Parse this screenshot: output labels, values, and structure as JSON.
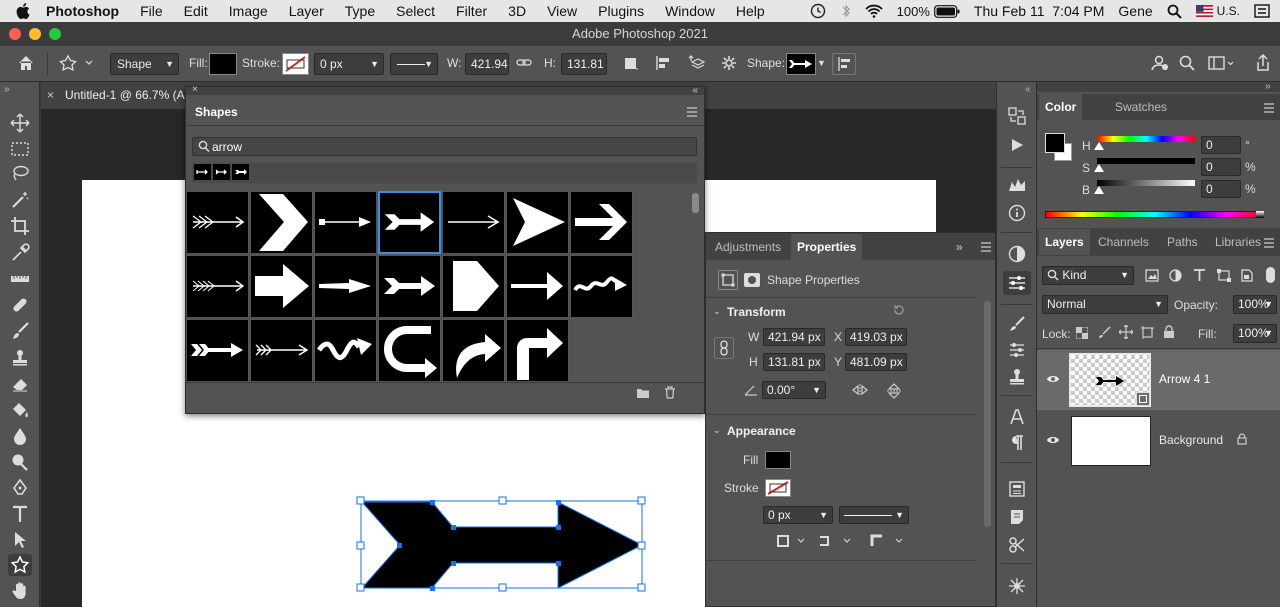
{
  "menubar": {
    "app": "Photoshop",
    "items": [
      "File",
      "Edit",
      "Image",
      "Layer",
      "Type",
      "Select",
      "Filter",
      "3D",
      "View",
      "Plugins",
      "Window",
      "Help"
    ],
    "battery": "100%",
    "datetime": "Thu Feb 11  7:04 PM",
    "user": "Gene",
    "input_source": "U.S."
  },
  "window": {
    "title": "Adobe Photoshop 2021"
  },
  "options": {
    "mode": "Shape",
    "fill_label": "Fill:",
    "stroke_label": "Stroke:",
    "stroke_width": "0 px",
    "w_label": "W:",
    "w_value": "421.94",
    "h_label": "H:",
    "h_value": "131.81 p",
    "shape_label": "Shape:"
  },
  "document": {
    "tab": "Untitled-1 @ 66.7% (A"
  },
  "shapes_panel": {
    "title": "Shapes",
    "search": "arrow",
    "tiles": [
      "feather-arrow",
      "chevron",
      "thin-arrow",
      "double-head-arrow",
      "line-arrow",
      "dart-arrow",
      "bold-arrow",
      "feather-arrow-2",
      "block-arrow",
      "taper-arrow",
      "notched-arrow",
      "pentagon-arrow",
      "thick-arrow",
      "wave-arrow",
      "fletched-arrow",
      "thin-fletched-arrow",
      "squiggle-arrow",
      "u-turn-arrow",
      "curved-arrow",
      "bent-arrow"
    ]
  },
  "properties_panel": {
    "tab_adjustments": "Adjustments",
    "tab_properties": "Properties",
    "subtitle": "Shape Properties",
    "transform": "Transform",
    "w_label": "W",
    "w": "421.94 px",
    "x_label": "X",
    "x": "419.03 px",
    "h_label": "H",
    "h": "131.81 px",
    "y_label": "Y",
    "y": "481.09 px",
    "angle": "0.00°",
    "appearance": "Appearance",
    "fill_label": "Fill",
    "stroke_label": "Stroke",
    "stroke_width": "0 px"
  },
  "color_panel": {
    "tab_color": "Color",
    "tab_swatches": "Swatches",
    "h_label": "H",
    "h": "0",
    "h_unit": "°",
    "s_label": "S",
    "s": "0",
    "s_unit": "%",
    "b_label": "B",
    "b": "0",
    "b_unit": "%"
  },
  "layers_panel": {
    "tabs": [
      "Layers",
      "Channels",
      "Paths",
      "Libraries"
    ],
    "filter": "Kind",
    "blend": "Normal",
    "opacity_label": "Opacity:",
    "opacity": "100%",
    "lock_label": "Lock:",
    "fill_label": "Fill:",
    "fill": "100%",
    "layers": [
      {
        "name": "Arrow 4 1"
      },
      {
        "name": "Background"
      }
    ]
  },
  "colors": {
    "accent": "#3a8ee6",
    "selection": "#1473e6"
  }
}
